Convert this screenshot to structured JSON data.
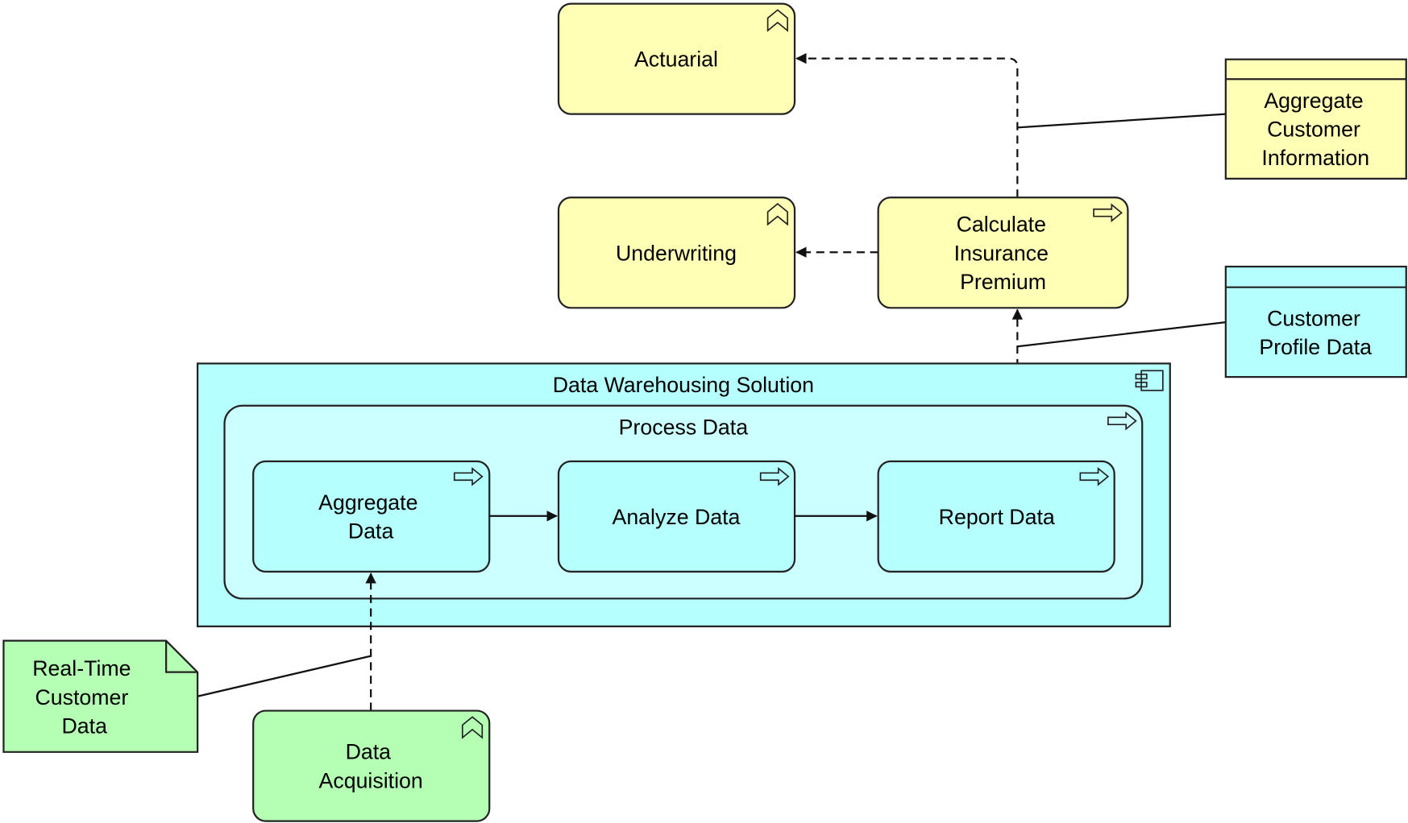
{
  "colors": {
    "business": "#ffffb5",
    "application": "#b5ffff",
    "application_inner": "#ccffff",
    "technology": "#b5ffb5"
  },
  "elements": {
    "actuarial": {
      "lines": [
        "Actuarial"
      ],
      "icon": "business-function-icon"
    },
    "underwriting": {
      "lines": [
        "Underwriting"
      ],
      "icon": "business-function-icon"
    },
    "calculate_premium": {
      "lines": [
        "Calculate",
        "Insurance",
        "Premium"
      ],
      "icon": "process-arrow-icon"
    },
    "aggregate_customer_information": {
      "lines": [
        "Aggregate",
        "Customer",
        "Information"
      ]
    },
    "customer_profile_data": {
      "lines": [
        "Customer",
        "Profile Data"
      ]
    },
    "data_warehousing_solution": {
      "lines": [
        "Data Warehousing Solution"
      ],
      "icon": "component-icon"
    },
    "process_data": {
      "lines": [
        "Process Data"
      ],
      "icon": "process-arrow-icon"
    },
    "aggregate_data": {
      "lines": [
        "Aggregate",
        "Data"
      ],
      "icon": "process-arrow-icon"
    },
    "analyze_data": {
      "lines": [
        "Analyze Data"
      ],
      "icon": "process-arrow-icon"
    },
    "report_data": {
      "lines": [
        "Report Data"
      ],
      "icon": "process-arrow-icon"
    },
    "real_time_customer_data": {
      "lines": [
        "Real-Time",
        "Customer",
        "Data"
      ]
    },
    "data_acquisition": {
      "lines": [
        "Data",
        "Acquisition"
      ],
      "icon": "function-icon"
    }
  }
}
